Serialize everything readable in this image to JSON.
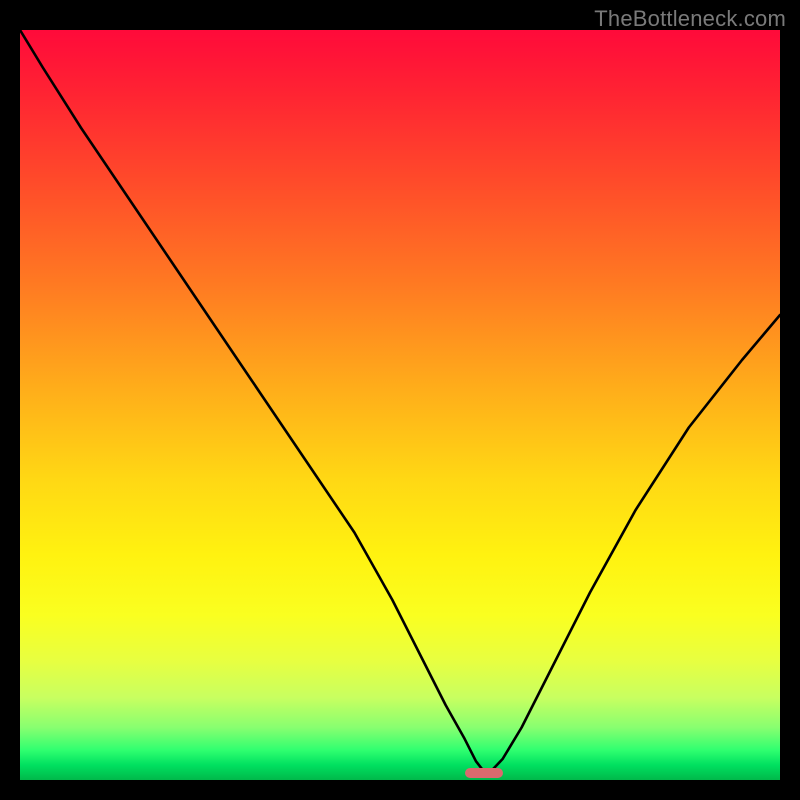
{
  "watermark": "TheBottleneck.com",
  "colors": {
    "frame_bg": "#000000",
    "marker": "#d96a6e",
    "curve": "#000000"
  },
  "chart_data": {
    "type": "line",
    "title": "",
    "xlabel": "",
    "ylabel": "",
    "xlim": [
      0,
      100
    ],
    "ylim": [
      0,
      100
    ],
    "x": [
      0,
      3,
      8,
      14,
      20,
      26,
      32,
      38,
      44,
      49,
      53,
      56,
      58.5,
      60,
      61,
      62,
      63.5,
      66,
      70,
      75,
      81,
      88,
      95,
      100
    ],
    "y": [
      100,
      95,
      87,
      78,
      69,
      60,
      51,
      42,
      33,
      24,
      16,
      10,
      5.5,
      2.5,
      1.2,
      1.2,
      2.8,
      7,
      15,
      25,
      36,
      47,
      56,
      62
    ],
    "series": [
      {
        "name": "bottleneck-curve",
        "x_ref": "x",
        "y_ref": "y"
      }
    ],
    "marker": {
      "x_center": 61,
      "width_pct": 5,
      "y": 0
    },
    "background_gradient": {
      "axis": "y",
      "stops": [
        {
          "y": 100,
          "color": "#ff0a3a"
        },
        {
          "y": 70,
          "color": "#ff7a22"
        },
        {
          "y": 40,
          "color": "#ffd814"
        },
        {
          "y": 18,
          "color": "#faff20"
        },
        {
          "y": 5,
          "color": "#88ff70"
        },
        {
          "y": 0,
          "color": "#00b84a"
        }
      ]
    }
  }
}
